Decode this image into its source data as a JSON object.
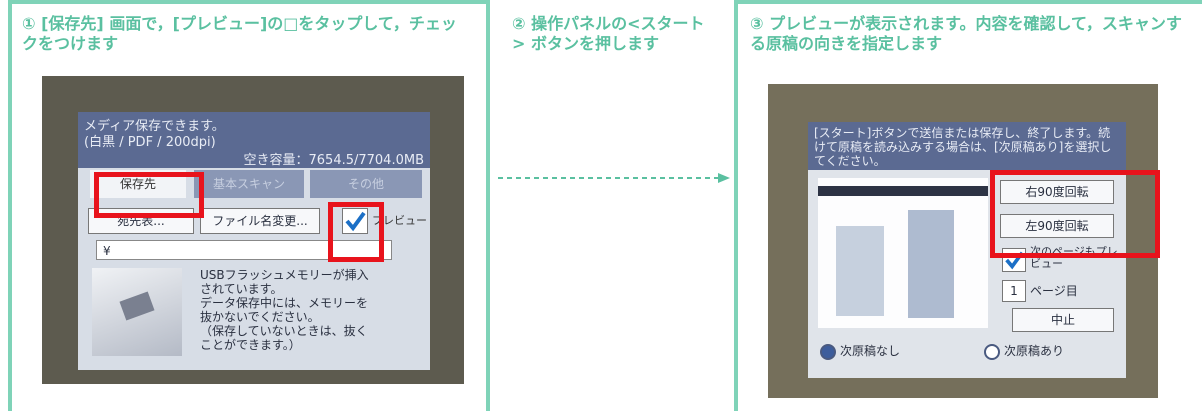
{
  "steps": {
    "step1": "① [保存先] 画面で，[プレビュー]の□をタップして，チェックをつけます",
    "step2": "② 操作パネルの<スタート> ボタンを押します",
    "step3": "③ プレビューが表示されます。内容を確認して，スキャンする原稿の向きを指定します"
  },
  "screen1": {
    "line1": "メディア保存できます。",
    "line2": "(白黒 / PDF / 200dpi)",
    "free_space": "空き容量：7654.5/7704.0MB",
    "tabs": [
      "保存先",
      "基本スキャン",
      "その他"
    ],
    "dest_button": "宛先表...",
    "filename_button": "ファイル名変更...",
    "preview_checkbox_label": "プレビュー",
    "path_value": "¥",
    "notice": [
      "USBフラッシュメモリーが挿入",
      "されています。",
      "データ保存中には、メモリーを",
      "抜かないでください。",
      "（保存していないときは、抜く",
      "ことができます。）"
    ]
  },
  "screen3": {
    "header": "[スタート]ボタンで送信または保存し、終了します。続けて原稿を読み込みする場合は、[次原稿あり]を選択してください。",
    "rotate_right": "右90度回転",
    "rotate_left": "左90度回転",
    "next_page_preview": "次のページもプレビュー",
    "page_value": "1",
    "page_unit": "ページ目",
    "stop": "中止",
    "radio_none": "次原稿なし",
    "radio_next": "次原稿あり"
  },
  "colors": {
    "accent_green": "#5ac0a0",
    "frame_green": "#7fd3b8",
    "highlight_red": "#e8131c"
  }
}
